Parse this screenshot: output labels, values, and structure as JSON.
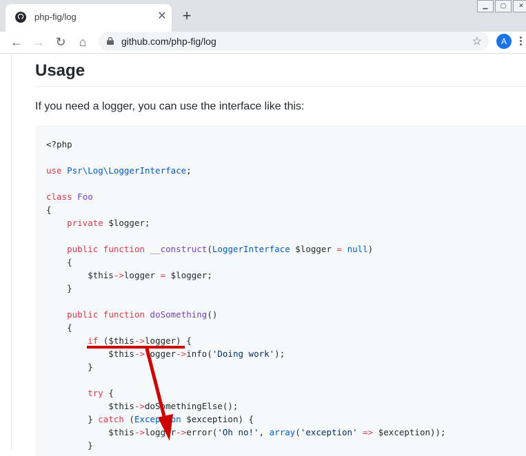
{
  "tab": {
    "title": "php-fig/log",
    "close_icon": "close-icon",
    "new_tab_icon": "plus-icon"
  },
  "window": {
    "minimize": "minimize-icon",
    "restore": "restore-icon",
    "close": "close-icon"
  },
  "toolbar": {
    "url": "github.com/php-fig/log",
    "avatar_letter": "A"
  },
  "content": {
    "heading": "Usage",
    "intro": "If you need a logger, you can use the interface like this:"
  },
  "code_lines": [
    [
      [
        "",
        "<?php"
      ]
    ],
    [],
    [
      [
        "kw",
        "use"
      ],
      [
        "",
        " "
      ],
      [
        "con",
        "Psr\\Log\\LoggerInterface"
      ],
      [
        "",
        ";"
      ]
    ],
    [],
    [
      [
        "kw",
        "class"
      ],
      [
        "",
        " "
      ],
      [
        "cls",
        "Foo"
      ]
    ],
    [
      [
        "",
        "{"
      ]
    ],
    [
      [
        "",
        "    "
      ],
      [
        "kw",
        "private"
      ],
      [
        "",
        " $logger;"
      ]
    ],
    [],
    [
      [
        "",
        "    "
      ],
      [
        "kw",
        "public"
      ],
      [
        "",
        " "
      ],
      [
        "kw",
        "function"
      ],
      [
        "",
        " "
      ],
      [
        "cls",
        "__construct"
      ],
      [
        "",
        "("
      ],
      [
        "con",
        "LoggerInterface"
      ],
      [
        "",
        " $logger "
      ],
      [
        "kw",
        "="
      ],
      [
        "",
        " "
      ],
      [
        "con",
        "null"
      ],
      [
        "",
        ")"
      ]
    ],
    [
      [
        "",
        "    {"
      ]
    ],
    [
      [
        "",
        "        $this"
      ],
      [
        "kw",
        "->"
      ],
      [
        "",
        "logger "
      ],
      [
        "kw",
        "="
      ],
      [
        "",
        " $logger;"
      ]
    ],
    [
      [
        "",
        "    }"
      ]
    ],
    [],
    [
      [
        "",
        "    "
      ],
      [
        "kw",
        "public"
      ],
      [
        "",
        " "
      ],
      [
        "kw",
        "function"
      ],
      [
        "",
        " "
      ],
      [
        "cls",
        "doSomething"
      ],
      [
        "",
        "()"
      ]
    ],
    [
      [
        "",
        "    {"
      ]
    ],
    [
      [
        "",
        "        "
      ],
      [
        "kw",
        "if"
      ],
      [
        "",
        " ($this"
      ],
      [
        "kw",
        "->"
      ],
      [
        "",
        "logger) {"
      ]
    ],
    [
      [
        "",
        "            $this"
      ],
      [
        "kw",
        "->"
      ],
      [
        "",
        "logger"
      ],
      [
        "kw",
        "->"
      ],
      [
        "",
        "info("
      ],
      [
        "str",
        "'Doing work'"
      ],
      [
        "",
        ");"
      ]
    ],
    [
      [
        "",
        "        }"
      ]
    ],
    [],
    [
      [
        "",
        "        "
      ],
      [
        "kw",
        "try"
      ],
      [
        "",
        " {"
      ]
    ],
    [
      [
        "",
        "            $this"
      ],
      [
        "kw",
        "->"
      ],
      [
        "",
        "doSomethingElse();"
      ]
    ],
    [
      [
        "",
        "        } "
      ],
      [
        "kw",
        "catch"
      ],
      [
        "",
        " ("
      ],
      [
        "con",
        "Exception"
      ],
      [
        "",
        " $exception) {"
      ]
    ],
    [
      [
        "",
        "            $this"
      ],
      [
        "kw",
        "->"
      ],
      [
        "",
        "logger"
      ],
      [
        "kw",
        "->"
      ],
      [
        "",
        "error("
      ],
      [
        "str",
        "'Oh no!'"
      ],
      [
        "",
        ", "
      ],
      [
        "con",
        "array"
      ],
      [
        "",
        "("
      ],
      [
        "str",
        "'exception'"
      ],
      [
        "",
        " "
      ],
      [
        "kw",
        "=>"
      ],
      [
        "",
        " $exception));"
      ]
    ],
    [
      [
        "",
        "        }"
      ]
    ]
  ],
  "annotation": {
    "color": "#cc0000"
  }
}
